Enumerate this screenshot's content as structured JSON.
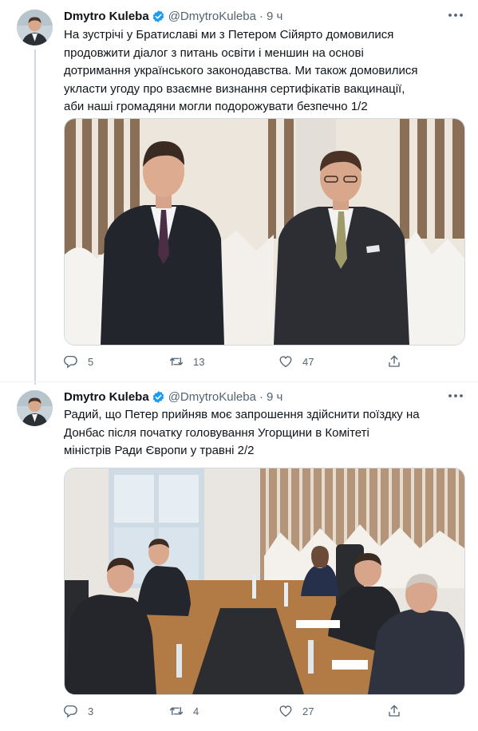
{
  "colors": {
    "accent": "#1d9bf0",
    "muted": "#536471",
    "text": "#0f1419",
    "border": "#cfd9de"
  },
  "tweets": [
    {
      "name": "Dmytro Kuleba",
      "handle": "@DmytroKuleba",
      "separator": "·",
      "time": "9 ч",
      "text_lines": [
        "На зустрічі у Братиславі ми з Петером Сійярто домовилися",
        "продовжити діалог з питань освіти і меншин на основі",
        "дотримання українського законодавства. Ми також домовилися",
        "укласти угоду про взаємне визнання сертифікатів вакцинації,",
        "аби наші громадяни могли подорожувати безпечно 1/2"
      ],
      "replies": "5",
      "retweets": "13",
      "likes": "47",
      "icons": [
        "verified-badge-icon",
        "more-icon",
        "reply-icon",
        "retweet-icon",
        "like-icon",
        "share-icon"
      ]
    },
    {
      "name": "Dmytro Kuleba",
      "handle": "@DmytroKuleba",
      "separator": "·",
      "time": "9 ч",
      "text_lines": [
        "Радий, що Петер прийняв моє запрошення здійснити поїздку на",
        "Донбас після початку головування Угорщини в Комітеті",
        "міністрів Ради Європи у травні 2/2"
      ],
      "replies": "3",
      "retweets": "4",
      "likes": "27",
      "icons": [
        "verified-badge-icon",
        "more-icon",
        "reply-icon",
        "retweet-icon",
        "like-icon",
        "share-icon"
      ]
    }
  ]
}
